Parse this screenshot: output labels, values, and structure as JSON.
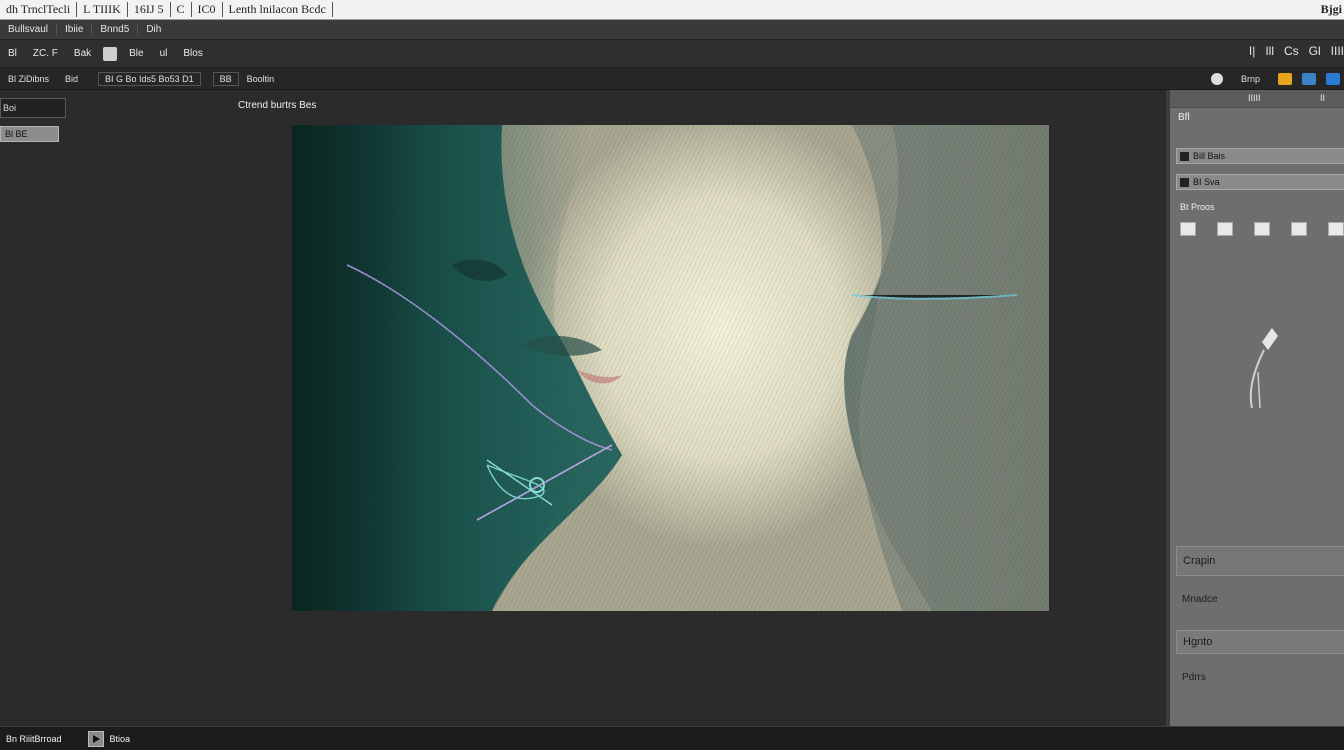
{
  "titlebar": {
    "items": [
      "dh TrnclTecli",
      "L TIIIK",
      "16IJ 5",
      "C",
      "IC0",
      "Lenth lnilacon Bcdc"
    ],
    "right": "Bjgi"
  },
  "menubar": {
    "items": [
      "Bullsvaul",
      "Ibiie",
      "Bnnd5",
      "Dih"
    ]
  },
  "optbar": {
    "items": [
      "Bl",
      "ZC. F",
      "Bak",
      "Ble",
      "ul",
      "Blos"
    ],
    "right": [
      "I|",
      "Ill",
      "Cs",
      "Gl",
      "IIII"
    ]
  },
  "optbar2": {
    "items": [
      "Bl ZiDibns",
      "Bid",
      "BI G Bo Ids5 Bo53 D1",
      "BB",
      "Booltin"
    ],
    "right_label": "Brnp",
    "swatches": {
      "c1": "#e7a41c",
      "c2": "#3b83c4",
      "c3": "#2a7bd5"
    }
  },
  "left": {
    "field": "Boi",
    "button": "Bl BE"
  },
  "document": {
    "title": "Ctrend burtrs Bes"
  },
  "rpanel": {
    "header": [
      "IIIII",
      "II"
    ],
    "sub": "Bfl",
    "layers": [
      "Bill Bais",
      "BI Sva"
    ],
    "props_label": "Bt Proos",
    "sections": [
      "Crapin",
      "Mnadce",
      "Hgnto",
      "Pdrrs"
    ]
  },
  "status": {
    "left": "Bn RiiitBrroad",
    "right": "Btioa"
  }
}
